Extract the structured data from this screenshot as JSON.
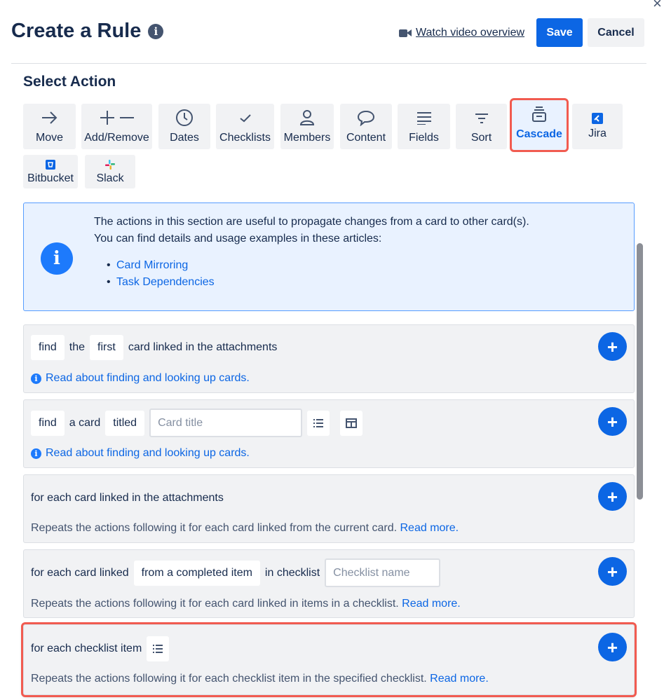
{
  "header": {
    "title": "Create a Rule",
    "video_link": "Watch video overview",
    "save_label": "Save",
    "cancel_label": "Cancel",
    "close_label": "×"
  },
  "section_title": "Select Action",
  "actions": [
    {
      "label": "Move",
      "icon": "arrow-right-icon"
    },
    {
      "label": "Add/Remove",
      "icon": "plus-minus-icon"
    },
    {
      "label": "Dates",
      "icon": "clock-icon"
    },
    {
      "label": "Checklists",
      "icon": "checkmark-icon"
    },
    {
      "label": "Members",
      "icon": "person-icon"
    },
    {
      "label": "Content",
      "icon": "speech-bubble-icon"
    },
    {
      "label": "Fields",
      "icon": "lines-icon"
    },
    {
      "label": "Sort",
      "icon": "filter-icon"
    },
    {
      "label": "Cascade",
      "icon": "cascade-icon",
      "selected": true
    },
    {
      "label": "Jira",
      "icon": "jira-icon"
    },
    {
      "label": "Bitbucket",
      "icon": "bitbucket-icon"
    },
    {
      "label": "Slack",
      "icon": "slack-icon"
    }
  ],
  "info": {
    "line1": "The actions in this section are useful to propagate changes from a card to other card(s).",
    "line2": "You can find details and usage examples in these articles:",
    "links": [
      "Card Mirroring",
      "Task Dependencies"
    ]
  },
  "cards": [
    {
      "parts": [
        "find",
        "the",
        "first",
        "card linked in the attachments"
      ],
      "help": "Read about finding and looking up cards."
    },
    {
      "parts": [
        "find",
        "a card",
        "titled"
      ],
      "input_placeholder": "Card title",
      "help": "Read about finding and looking up cards."
    },
    {
      "text": "for each card linked in the attachments",
      "desc": "Repeats the actions following it for each card linked from the current card.",
      "read_more": "Read more."
    },
    {
      "parts": [
        "for each card linked",
        "from a completed item",
        "in checklist"
      ],
      "input_placeholder": "Checklist name",
      "desc": "Repeats the actions following it for each card linked in items in a checklist.",
      "read_more": "Read more."
    },
    {
      "text": "for each checklist item",
      "desc": "Repeats the actions following it for each checklist item in the specified checklist.",
      "read_more": "Read more."
    }
  ],
  "colors": {
    "primary": "#0c66e4",
    "highlight": "#f15b50",
    "info_bg": "#e9f2ff"
  }
}
